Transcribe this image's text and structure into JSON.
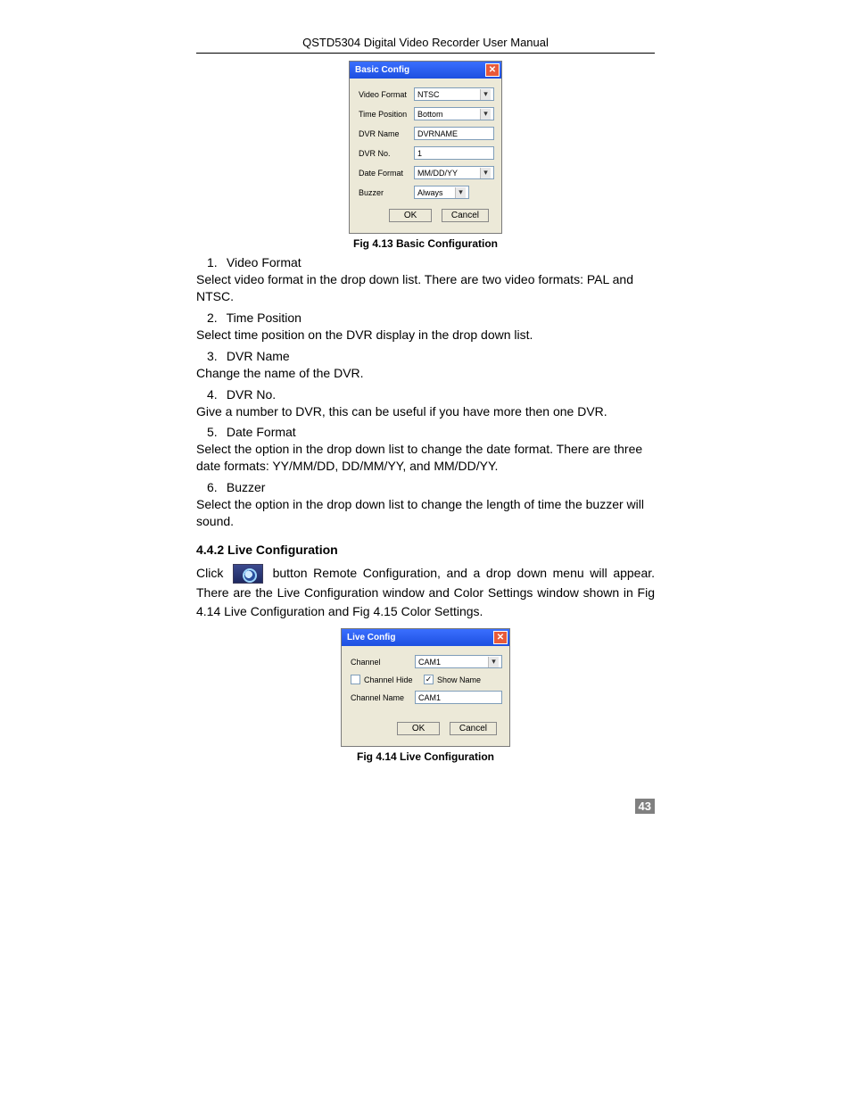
{
  "header": "QSTD5304 Digital Video Recorder User Manual",
  "dialog1": {
    "title": "Basic Config",
    "fields": {
      "videoFormat": {
        "label": "Video Format",
        "value": "NTSC",
        "dropdown": true
      },
      "timePosition": {
        "label": "Time Position",
        "value": "Bottom",
        "dropdown": true
      },
      "dvrName": {
        "label": "DVR Name",
        "value": "DVRNAME",
        "dropdown": false
      },
      "dvrNo": {
        "label": "DVR No.",
        "value": "1",
        "dropdown": false
      },
      "dateFormat": {
        "label": "Date Format",
        "value": "MM/DD/YY",
        "dropdown": true
      },
      "buzzer": {
        "label": "Buzzer",
        "value": "Always",
        "dropdown": true
      }
    },
    "buttons": {
      "ok": "OK",
      "cancel": "Cancel"
    }
  },
  "caption1": "Fig 4.13 Basic Configuration",
  "items": [
    {
      "num": "1.",
      "title": "Video Format",
      "text": "Select video format in the drop down list. There are two video formats: PAL and NTSC."
    },
    {
      "num": "2.",
      "title": "Time Position",
      "text": "Select time position on the DVR display in the drop down list."
    },
    {
      "num": "3.",
      "title": "DVR Name",
      "text": "Change the name of the DVR."
    },
    {
      "num": "4.",
      "title": "DVR No.",
      "text": "Give a number to DVR, this can be useful if you have more then one DVR."
    },
    {
      "num": "5.",
      "title": "Date Format",
      "text": "Select the option in the drop down list to change the date format. There are three date formats: YY/MM/DD, DD/MM/YY, and MM/DD/YY."
    },
    {
      "num": "6.",
      "title": "Buzzer",
      "text": "Select the option in the drop down list to change the length of time the buzzer will sound."
    }
  ],
  "sectionHead": "4.4.2  Live Configuration",
  "clickPara": {
    "a": "Click",
    "b": "button Remote Configuration, and a drop down menu will appear. There are the Live Configuration window and Color Settings window shown in Fig 4.14 Live Configuration and Fig 4.15 Color Settings."
  },
  "dialog2": {
    "title": "Live Config",
    "channel": {
      "label": "Channel",
      "value": "CAM1"
    },
    "channelHide": {
      "label": "Channel Hide",
      "checked": false
    },
    "showName": {
      "label": "Show Name",
      "checked": true
    },
    "channelName": {
      "label": "Channel Name",
      "value": "CAM1"
    },
    "buttons": {
      "ok": "OK",
      "cancel": "Cancel"
    }
  },
  "caption2": "Fig 4.14 Live Configuration",
  "pageNumber": "43"
}
